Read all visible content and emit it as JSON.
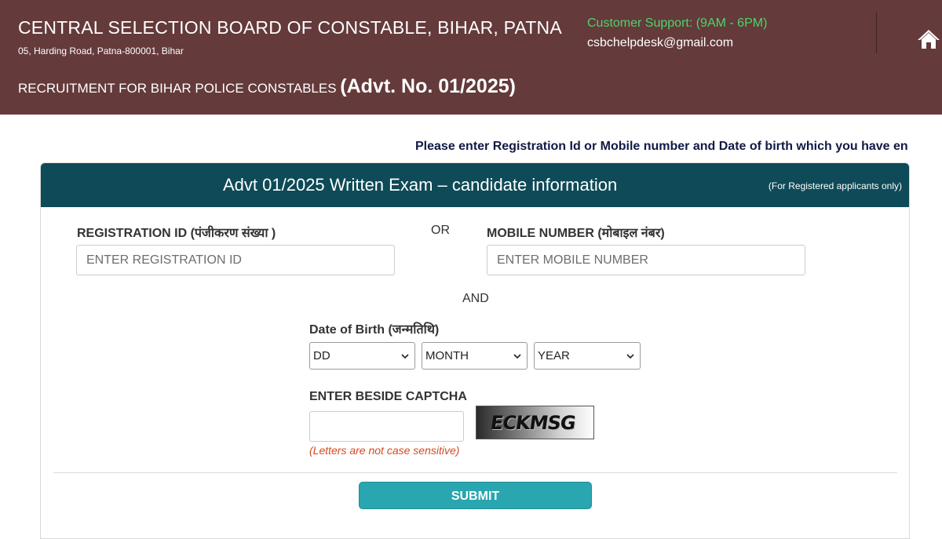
{
  "header": {
    "org_name": "CENTRAL SELECTION BOARD OF CONSTABLE, BIHAR, PATNA",
    "address": "05, Harding Road, Patna-800001, Bihar",
    "recruitment_prefix": "RECRUITMENT FOR BIHAR POLICE CONSTABLES ",
    "advt_number": "(Advt. No. 01/2025)",
    "support_label": "Customer Support: (9AM - 6PM)",
    "support_email": "csbchelpdesk@gmail.com",
    "home_icon": "home-icon",
    "colors": {
      "background": "#643a3b",
      "support_label": "#4fd36a"
    }
  },
  "instruction": "Please enter Registration Id or Mobile number and Date of birth which you have entered",
  "panel": {
    "title": "Advt 01/2025 Written Exam – candidate information",
    "note": "(For Registered applicants only)",
    "header_color": "#0e4a57"
  },
  "form": {
    "registration_label": "REGISTRATION ID (पंजीकरण संख्या )",
    "registration_placeholder": "ENTER REGISTRATION ID",
    "or_text": "OR",
    "mobile_label": "MOBILE NUMBER (मोबाइल नंबर)",
    "mobile_placeholder": "ENTER MOBILE NUMBER",
    "and_text": "AND",
    "dob_label": "Date of Birth (जन्मतिथि)",
    "dob_day": "DD",
    "dob_month": "MONTH",
    "dob_year": "YEAR",
    "captcha_label": "ENTER BESIDE CAPTCHA",
    "captcha_value": "",
    "captcha_text": "ECKMSG",
    "captcha_hint": "(Letters are not case sensitive)",
    "submit_label": "SUBMIT",
    "submit_color": "#29a6b0",
    "hint_color": "#d34a1e"
  }
}
